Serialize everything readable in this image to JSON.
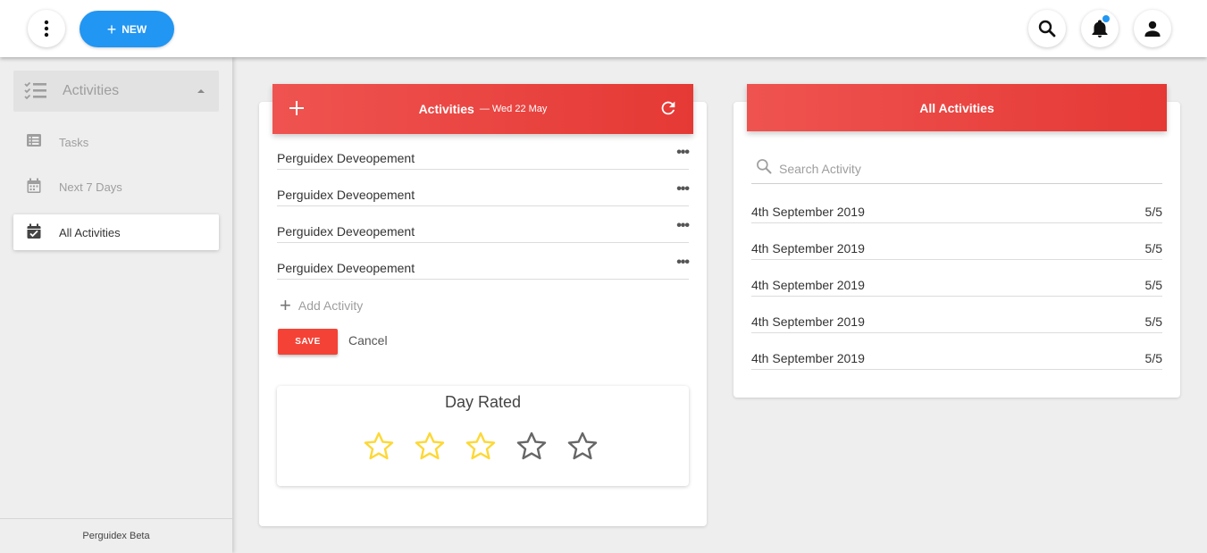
{
  "topbar": {
    "menu_icon": "more-vert-icon",
    "new_button_label": "NEW",
    "icons": [
      "search-icon",
      "bell-icon",
      "account-icon"
    ],
    "notification_dot_color": "#2196f3"
  },
  "sidebar": {
    "header": {
      "label": "Activities",
      "icon": "checklist-icon"
    },
    "items": [
      {
        "label": "Tasks",
        "icon": "list-icon",
        "active": false
      },
      {
        "label": "Next 7 Days",
        "icon": "calendar-icon",
        "active": false
      },
      {
        "label": "All Activities",
        "icon": "calendar-check-icon",
        "active": true
      }
    ],
    "footer": "Perguidex Beta"
  },
  "activities_card": {
    "title": "Activities",
    "subtitle": "— Wed 22 May",
    "items": [
      {
        "name": "Perguidex Deveopement"
      },
      {
        "name": "Perguidex Deveopement"
      },
      {
        "name": "Perguidex Deveopement"
      },
      {
        "name": "Perguidex Deveopement"
      }
    ],
    "add_label": "Add Activity",
    "save_label": "SAVE",
    "cancel_label": "Cancel",
    "rating": {
      "title": "Day Rated",
      "value": 3,
      "max": 5
    }
  },
  "all_activities_card": {
    "title": "All Activities",
    "search_placeholder": "Search Activity",
    "rows": [
      {
        "date": "4th September 2019",
        "score": "5/5"
      },
      {
        "date": "4th September 2019",
        "score": "5/5"
      },
      {
        "date": "4th September 2019",
        "score": "5/5"
      },
      {
        "date": "4th September 2019",
        "score": "5/5"
      },
      {
        "date": "4th September 2019",
        "score": "5/5"
      }
    ]
  },
  "colors": {
    "accent_red": "#f44336",
    "primary_blue": "#2196f3",
    "star_filled": "#fdd835",
    "star_empty": "#666666"
  }
}
